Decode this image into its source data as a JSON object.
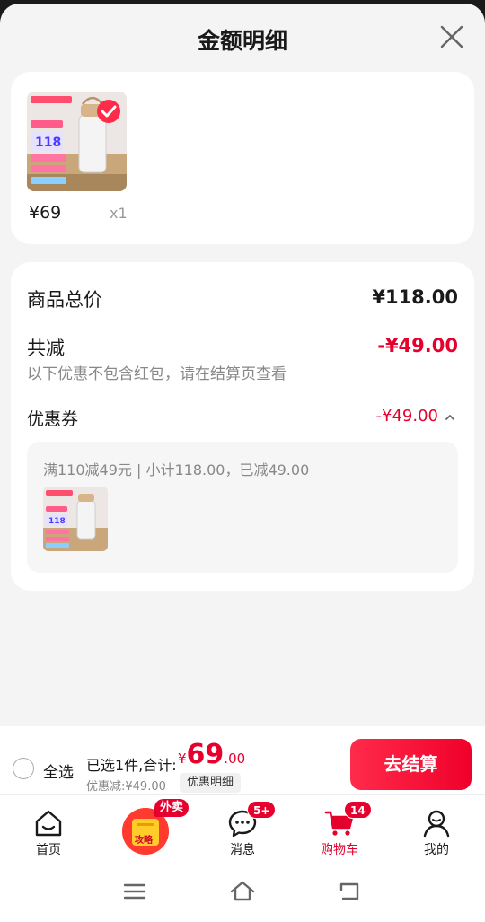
{
  "sheet": {
    "title": "金额明细"
  },
  "product": {
    "price": "¥69",
    "qty": "x1"
  },
  "detail": {
    "total_label": "商品总价",
    "total_value": "¥118.00",
    "reduce_label": "共减",
    "reduce_value": "-¥49.00",
    "note": "以下优惠不包含红包，请在结算页查看",
    "coupon_label": "优惠券",
    "coupon_value": "-¥49.00",
    "coupon_desc": "满110减49元 | 小计118.00，已减49.00"
  },
  "checkout": {
    "select_all": "全选",
    "selected_text": "已选1件,合计:",
    "currency": "¥",
    "total_int": "69",
    "total_dec": ".00",
    "discount": "优惠减:¥49.00",
    "detail_chip": "优惠明细",
    "button": "去结算"
  },
  "tabs": [
    {
      "label": "首页",
      "icon": "home-icon"
    },
    {
      "label": "",
      "icon": "promo-icon",
      "badge": "外卖",
      "icon_text": "攻略"
    },
    {
      "label": "消息",
      "icon": "message-icon",
      "badge": "5+"
    },
    {
      "label": "购物车",
      "icon": "cart-icon",
      "badge": "14",
      "active": true
    },
    {
      "label": "我的",
      "icon": "profile-icon"
    }
  ],
  "colors": {
    "accent": "#e5002d",
    "background": "#f4f4f4"
  }
}
